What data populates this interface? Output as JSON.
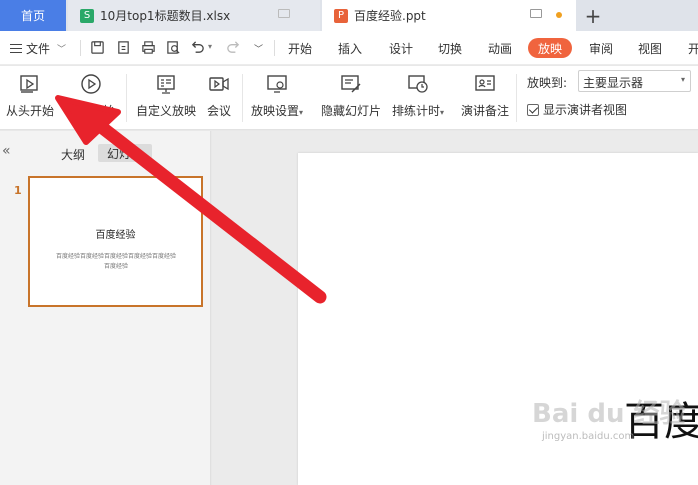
{
  "tabs": {
    "home": "首页",
    "xlsx": {
      "badge": "S",
      "title": "10月top1标题数目.xlsx"
    },
    "ppt": {
      "badge": "P",
      "title": "百度经验.ppt"
    },
    "add": "+"
  },
  "menu": {
    "file": "文件",
    "items": [
      "开始",
      "插入",
      "设计",
      "切换",
      "动画",
      "放映",
      "审阅",
      "视图",
      "开"
    ],
    "active": "放映"
  },
  "toolbar": {
    "from_start": "从头开始",
    "from_current": "当页开始",
    "custom_show": "自定义放映",
    "meeting": "会议",
    "show_settings": "放映设置",
    "hide_slide": "隐藏幻灯片",
    "rehearse": "排练计时",
    "notes": "演讲备注",
    "output_label": "放映到:",
    "output_value": "主要显示器",
    "presenter_view": "显示演讲者视图"
  },
  "leftpanel": {
    "collapse": "«",
    "outline": "大纲",
    "slides": "幻灯片",
    "slide_number": "1",
    "thumb_title": "百度经验",
    "thumb_body": "百度经验百度经验百度经验百度经验百度经验百度经验"
  },
  "slide": {
    "title": "百度",
    "watermark": "Bai du 经验",
    "watermark_sub": "jingyan.baidu.com"
  },
  "colors": {
    "accent_tab": "#4a7ee6",
    "active_menu": "#f0643e",
    "arrow": "#e8232c",
    "thumb_border": "#c8742a"
  }
}
